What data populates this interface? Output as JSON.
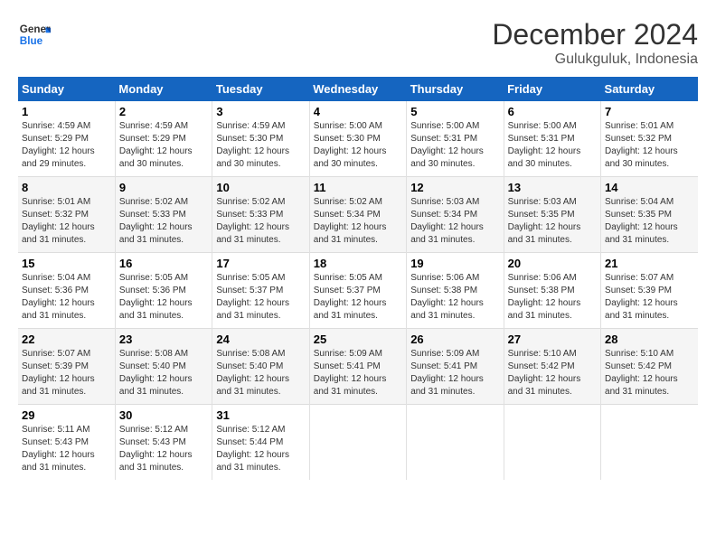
{
  "header": {
    "logo_line1": "General",
    "logo_line2": "Blue",
    "month": "December 2024",
    "location": "Gulukguluk, Indonesia"
  },
  "weekdays": [
    "Sunday",
    "Monday",
    "Tuesday",
    "Wednesday",
    "Thursday",
    "Friday",
    "Saturday"
  ],
  "weeks": [
    [
      {
        "day": "1",
        "sunrise": "4:59 AM",
        "sunset": "5:29 PM",
        "daylight": "12 hours and 29 minutes."
      },
      {
        "day": "2",
        "sunrise": "4:59 AM",
        "sunset": "5:29 PM",
        "daylight": "12 hours and 30 minutes."
      },
      {
        "day": "3",
        "sunrise": "4:59 AM",
        "sunset": "5:30 PM",
        "daylight": "12 hours and 30 minutes."
      },
      {
        "day": "4",
        "sunrise": "5:00 AM",
        "sunset": "5:30 PM",
        "daylight": "12 hours and 30 minutes."
      },
      {
        "day": "5",
        "sunrise": "5:00 AM",
        "sunset": "5:31 PM",
        "daylight": "12 hours and 30 minutes."
      },
      {
        "day": "6",
        "sunrise": "5:00 AM",
        "sunset": "5:31 PM",
        "daylight": "12 hours and 30 minutes."
      },
      {
        "day": "7",
        "sunrise": "5:01 AM",
        "sunset": "5:32 PM",
        "daylight": "12 hours and 30 minutes."
      }
    ],
    [
      {
        "day": "8",
        "sunrise": "5:01 AM",
        "sunset": "5:32 PM",
        "daylight": "12 hours and 31 minutes."
      },
      {
        "day": "9",
        "sunrise": "5:02 AM",
        "sunset": "5:33 PM",
        "daylight": "12 hours and 31 minutes."
      },
      {
        "day": "10",
        "sunrise": "5:02 AM",
        "sunset": "5:33 PM",
        "daylight": "12 hours and 31 minutes."
      },
      {
        "day": "11",
        "sunrise": "5:02 AM",
        "sunset": "5:34 PM",
        "daylight": "12 hours and 31 minutes."
      },
      {
        "day": "12",
        "sunrise": "5:03 AM",
        "sunset": "5:34 PM",
        "daylight": "12 hours and 31 minutes."
      },
      {
        "day": "13",
        "sunrise": "5:03 AM",
        "sunset": "5:35 PM",
        "daylight": "12 hours and 31 minutes."
      },
      {
        "day": "14",
        "sunrise": "5:04 AM",
        "sunset": "5:35 PM",
        "daylight": "12 hours and 31 minutes."
      }
    ],
    [
      {
        "day": "15",
        "sunrise": "5:04 AM",
        "sunset": "5:36 PM",
        "daylight": "12 hours and 31 minutes."
      },
      {
        "day": "16",
        "sunrise": "5:05 AM",
        "sunset": "5:36 PM",
        "daylight": "12 hours and 31 minutes."
      },
      {
        "day": "17",
        "sunrise": "5:05 AM",
        "sunset": "5:37 PM",
        "daylight": "12 hours and 31 minutes."
      },
      {
        "day": "18",
        "sunrise": "5:05 AM",
        "sunset": "5:37 PM",
        "daylight": "12 hours and 31 minutes."
      },
      {
        "day": "19",
        "sunrise": "5:06 AM",
        "sunset": "5:38 PM",
        "daylight": "12 hours and 31 minutes."
      },
      {
        "day": "20",
        "sunrise": "5:06 AM",
        "sunset": "5:38 PM",
        "daylight": "12 hours and 31 minutes."
      },
      {
        "day": "21",
        "sunrise": "5:07 AM",
        "sunset": "5:39 PM",
        "daylight": "12 hours and 31 minutes."
      }
    ],
    [
      {
        "day": "22",
        "sunrise": "5:07 AM",
        "sunset": "5:39 PM",
        "daylight": "12 hours and 31 minutes."
      },
      {
        "day": "23",
        "sunrise": "5:08 AM",
        "sunset": "5:40 PM",
        "daylight": "12 hours and 31 minutes."
      },
      {
        "day": "24",
        "sunrise": "5:08 AM",
        "sunset": "5:40 PM",
        "daylight": "12 hours and 31 minutes."
      },
      {
        "day": "25",
        "sunrise": "5:09 AM",
        "sunset": "5:41 PM",
        "daylight": "12 hours and 31 minutes."
      },
      {
        "day": "26",
        "sunrise": "5:09 AM",
        "sunset": "5:41 PM",
        "daylight": "12 hours and 31 minutes."
      },
      {
        "day": "27",
        "sunrise": "5:10 AM",
        "sunset": "5:42 PM",
        "daylight": "12 hours and 31 minutes."
      },
      {
        "day": "28",
        "sunrise": "5:10 AM",
        "sunset": "5:42 PM",
        "daylight": "12 hours and 31 minutes."
      }
    ],
    [
      {
        "day": "29",
        "sunrise": "5:11 AM",
        "sunset": "5:43 PM",
        "daylight": "12 hours and 31 minutes."
      },
      {
        "day": "30",
        "sunrise": "5:12 AM",
        "sunset": "5:43 PM",
        "daylight": "12 hours and 31 minutes."
      },
      {
        "day": "31",
        "sunrise": "5:12 AM",
        "sunset": "5:44 PM",
        "daylight": "12 hours and 31 minutes."
      },
      null,
      null,
      null,
      null
    ]
  ],
  "labels": {
    "sunrise": "Sunrise: ",
    "sunset": "Sunset: ",
    "daylight": "Daylight: "
  }
}
